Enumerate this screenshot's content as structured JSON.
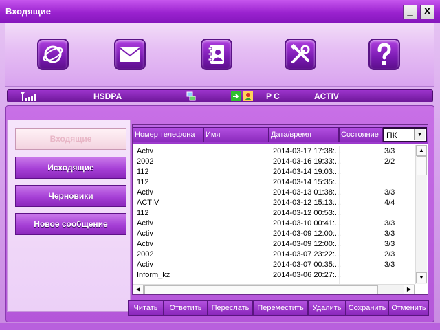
{
  "window": {
    "title": "Входящие",
    "minimize_label": "_",
    "close_label": "X"
  },
  "toolbar": {
    "buttons": [
      {
        "name": "internet",
        "icon": "globe-icon"
      },
      {
        "name": "messages",
        "icon": "envelope-icon"
      },
      {
        "name": "contacts",
        "icon": "address-book-icon"
      },
      {
        "name": "settings",
        "icon": "tools-icon"
      },
      {
        "name": "help",
        "icon": "question-icon"
      }
    ]
  },
  "status": {
    "signal_icon": "signal-strength-icon",
    "network_type": "HSDPA",
    "connection_icon": "network-connection-icon",
    "sms_icon": "sms-icon",
    "contact_icon": "contact-card-icon",
    "storage": "P C",
    "operator": "ACTIV"
  },
  "nav": {
    "inbox": "Входящие",
    "outbox": "Исходящие",
    "drafts": "Черновики",
    "new_message": "Новое сообщение"
  },
  "table": {
    "headers": {
      "phone": "Номер телефона",
      "name": "Имя",
      "datetime": "Дата/время",
      "state": "Состояние"
    },
    "filter": {
      "value": "ПК"
    },
    "rows": [
      {
        "phone": "Activ",
        "name": "",
        "datetime": "2014-03-17  17:38:...",
        "state": "3/3"
      },
      {
        "phone": "2002",
        "name": "",
        "datetime": "2014-03-16  19:33:...",
        "state": "2/2"
      },
      {
        "phone": "112",
        "name": "",
        "datetime": "2014-03-14  19:03:...",
        "state": ""
      },
      {
        "phone": "112",
        "name": "",
        "datetime": "2014-03-14  15:35:...",
        "state": ""
      },
      {
        "phone": "Activ",
        "name": "",
        "datetime": "2014-03-13  01:38:...",
        "state": "3/3"
      },
      {
        "phone": "ACTIV",
        "name": "",
        "datetime": "2014-03-12  15:13:...",
        "state": "4/4"
      },
      {
        "phone": "112",
        "name": "",
        "datetime": "2014-03-12  00:53:...",
        "state": ""
      },
      {
        "phone": "Activ",
        "name": "",
        "datetime": "2014-03-10  00:41:...",
        "state": "3/3"
      },
      {
        "phone": "Activ",
        "name": "",
        "datetime": "2014-03-09  12:00:...",
        "state": "3/3"
      },
      {
        "phone": "Activ",
        "name": "",
        "datetime": "2014-03-09  12:00:...",
        "state": "3/3"
      },
      {
        "phone": "2002",
        "name": "",
        "datetime": "2014-03-07  23:22:...",
        "state": "2/3"
      },
      {
        "phone": "Activ",
        "name": "",
        "datetime": "2014-03-07  00:35:...",
        "state": "3/3"
      },
      {
        "phone": "Inform_kz",
        "name": "",
        "datetime": "2014-03-06  20:27:...",
        "state": ""
      }
    ]
  },
  "actions": {
    "read": "Читать",
    "reply": "Ответить",
    "forward": "Переслать",
    "move": "Переместить",
    "delete": "Удалить",
    "save": "Сохранить",
    "cancel": "Отменить"
  }
}
